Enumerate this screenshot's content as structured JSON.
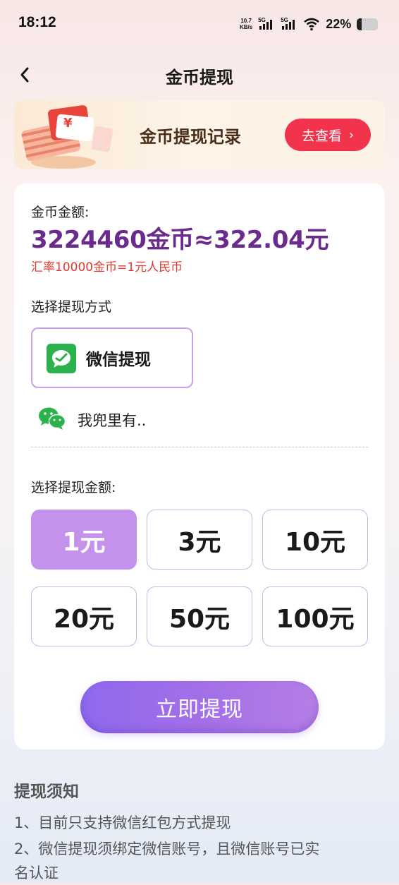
{
  "status": {
    "time": "18:12",
    "net_speed_value": "10.7",
    "net_speed_unit": "KB/s",
    "sim1": "5G",
    "sim2": "5G",
    "battery": "22%"
  },
  "header": {
    "title": "金币提现"
  },
  "banner": {
    "title": "金币提现记录",
    "button_label": "去查看",
    "button_chevron": "›"
  },
  "balance": {
    "label": "金币金额:",
    "value": "3224460金币≈322.04元",
    "rate": "汇率10000金币=1元人民币"
  },
  "method": {
    "label": "选择提现方式",
    "option_label": "微信提现",
    "option_icon": "wechat-pay-icon",
    "account_icon": "wechat-icon",
    "account_name": "我兜里有.."
  },
  "amount": {
    "label": "选择提现金额:",
    "options": [
      "1元",
      "3元",
      "10元",
      "20元",
      "50元",
      "100元"
    ],
    "selected": "1元"
  },
  "submit": {
    "label": "立即提现"
  },
  "notice": {
    "title": "提现须知",
    "lines": [
      "1、目前只支持微信红包方式提现",
      "2、微信提现须绑定微信账号，且微信账号已实",
      "名认证"
    ]
  },
  "colors": {
    "accent_purple": "#c492ec",
    "balance_purple": "#6b2a8e",
    "rate_red": "#e0392f",
    "banner_button": "#f1334c",
    "wechat_green": "#2bb24c"
  }
}
